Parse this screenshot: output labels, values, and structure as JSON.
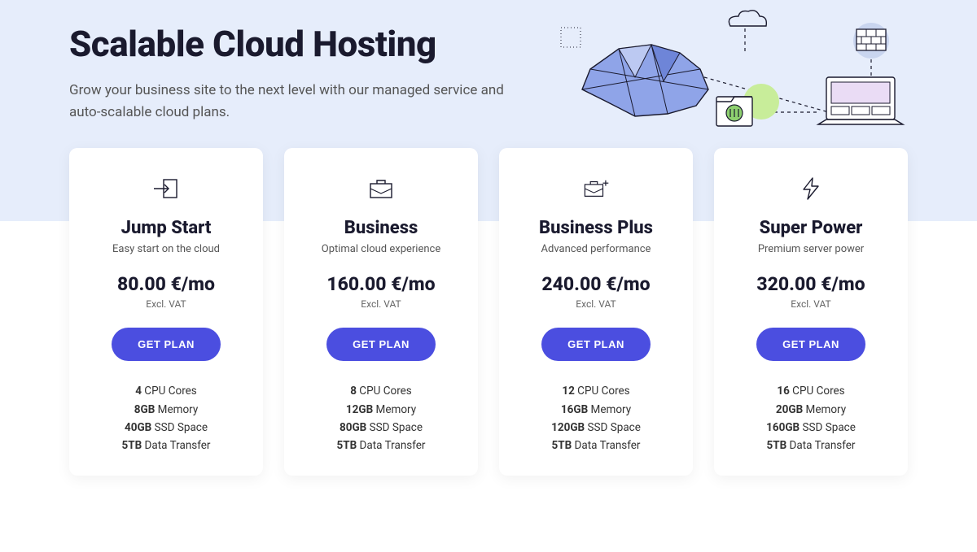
{
  "hero": {
    "title": "Scalable Cloud Hosting",
    "subtitle": "Grow your business site to the next level with our managed service and auto-scalable cloud plans."
  },
  "common": {
    "vat": "Excl. VAT",
    "cta": "GET PLAN",
    "currency_suffix": " €/mo"
  },
  "plans": [
    {
      "icon": "arrow-login-icon",
      "name": "Jump Start",
      "tagline": "Easy start on the cloud",
      "price": "80.00",
      "features": [
        {
          "bold": "4",
          "text": " CPU Cores"
        },
        {
          "bold": "8GB",
          "text": " Memory"
        },
        {
          "bold": "40GB",
          "text": " SSD Space"
        },
        {
          "bold": "5TB",
          "text": " Data Transfer"
        }
      ]
    },
    {
      "icon": "briefcase-icon",
      "name": "Business",
      "tagline": "Optimal cloud experience",
      "price": "160.00",
      "features": [
        {
          "bold": "8",
          "text": " CPU Cores"
        },
        {
          "bold": "12GB",
          "text": " Memory"
        },
        {
          "bold": "80GB",
          "text": " SSD Space"
        },
        {
          "bold": "5TB",
          "text": " Data Transfer"
        }
      ]
    },
    {
      "icon": "briefcase-plus-icon",
      "name": "Business Plus",
      "tagline": "Advanced performance",
      "price": "240.00",
      "features": [
        {
          "bold": "12",
          "text": " CPU Cores"
        },
        {
          "bold": "16GB",
          "text": " Memory"
        },
        {
          "bold": "120GB",
          "text": " SSD Space"
        },
        {
          "bold": "5TB",
          "text": " Data Transfer"
        }
      ]
    },
    {
      "icon": "lightning-icon",
      "name": "Super Power",
      "tagline": "Premium server power",
      "price": "320.00",
      "features": [
        {
          "bold": "16",
          "text": " CPU Cores"
        },
        {
          "bold": "20GB",
          "text": " Memory"
        },
        {
          "bold": "160GB",
          "text": " SSD Space"
        },
        {
          "bold": "5TB",
          "text": " Data Transfer"
        }
      ]
    }
  ]
}
